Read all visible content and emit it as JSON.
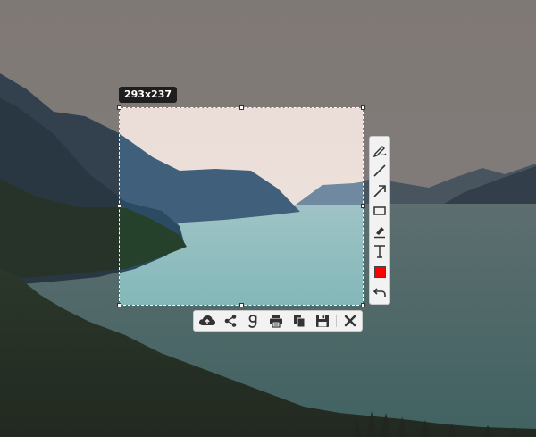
{
  "selection": {
    "size_label": "293x237"
  },
  "icons": {
    "pen": "pen-icon",
    "line": "line-icon",
    "arrow": "arrow-icon",
    "rectangle": "rectangle-icon",
    "marker": "marker-icon",
    "text": "text-icon",
    "color": "color-icon",
    "undo": "undo-icon",
    "upload": "cloud-upload-icon",
    "share": "share-icon",
    "google": "google-search-icon",
    "print": "print-icon",
    "copy": "copy-icon",
    "save": "save-icon",
    "close": "close-icon"
  },
  "colors": {
    "current_draw_color": "#ff0000"
  }
}
